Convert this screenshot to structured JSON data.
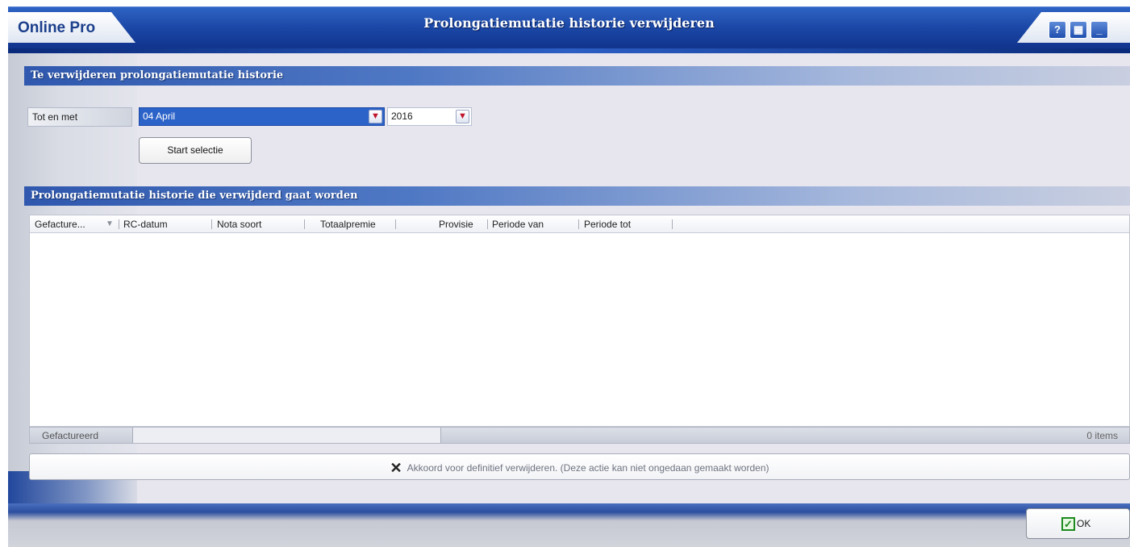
{
  "window": {
    "brand": "Online Pro",
    "title": "Prolongatiemutatie historie verwijderen",
    "buttons": [
      {
        "name": "help",
        "glyph": "?"
      },
      {
        "name": "print",
        "glyph": "▦"
      },
      {
        "name": "minimize",
        "glyph": "_"
      }
    ]
  },
  "section1": {
    "header": "Te verwijderen prolongatiemutatie historie",
    "date_label": "Tot en met",
    "month_value": "04 April",
    "year_value": "2016",
    "start_button": "Start selectie"
  },
  "section2": {
    "header": "Prolongatiemutatie historie die verwijderd gaat worden",
    "columns": [
      "Gefacture...",
      "RC-datum",
      "Nota soort",
      "Totaalpremie",
      "Provisie",
      "Periode van",
      "Periode tot"
    ],
    "rows": []
  },
  "statusbar": {
    "group_label": "Gefactureerd",
    "item_count": "0 items"
  },
  "confirm": {
    "label": "Akkoord voor definitief verwijderen.  (Deze actie kan niet ongedaan gemaakt worden)"
  },
  "footer": {
    "ok_label": "OK"
  },
  "colors": {
    "title_blue": "#1b47a6",
    "selection_blue": "#2c63c8",
    "ok_green": "#1e8a1e"
  }
}
